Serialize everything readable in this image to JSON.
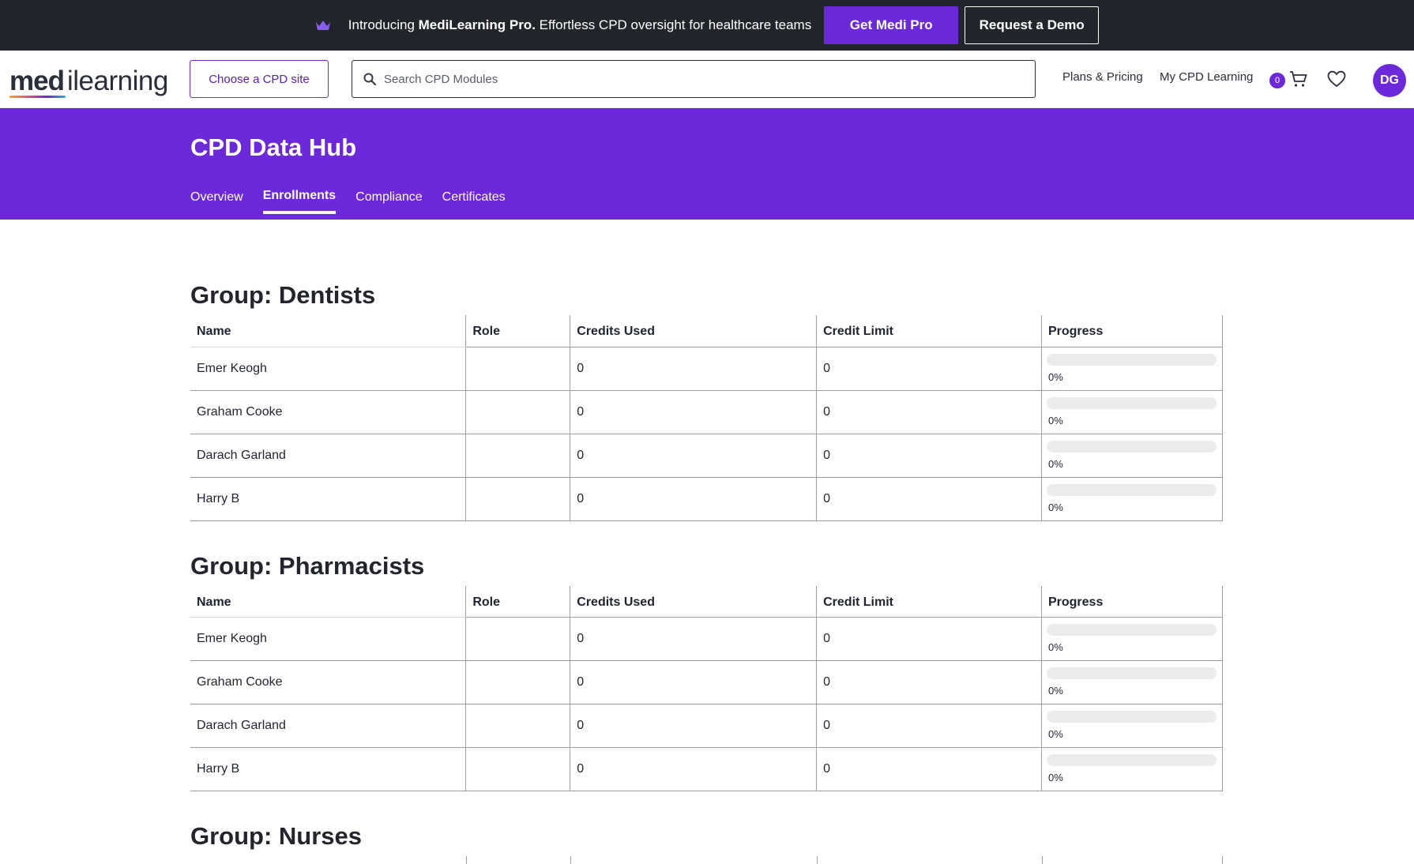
{
  "announcement": {
    "icon": "crown-icon",
    "intro": "Introducing ",
    "product": "MediLearning Pro.",
    "tagline": " Effortless CPD oversight for healthcare teams",
    "primary_cta": "Get Medi Pro",
    "secondary_cta": "Request a Demo"
  },
  "header": {
    "logo_bold": "med",
    "logo_light": "ilearning",
    "site_button": "Choose a CPD site",
    "search_placeholder": "Search CPD Modules",
    "nav": [
      "Plans & Pricing",
      "My CPD Learning"
    ],
    "cart_count": "0",
    "avatar_initials": "DG"
  },
  "hero": {
    "title": "CPD Data Hub",
    "tabs": [
      "Overview",
      "Enrollments",
      "Compliance",
      "Certificates"
    ],
    "active_tab": "Enrollments"
  },
  "table_headers": [
    "Name",
    "Role",
    "Credits Used",
    "Credit Limit",
    "Progress"
  ],
  "groups": [
    {
      "title": "Group: Dentists",
      "rows": [
        {
          "name": "Emer Keogh",
          "role": "",
          "credits_used": "0",
          "credit_limit": "0",
          "progress": "0%"
        },
        {
          "name": "Graham Cooke",
          "role": "",
          "credits_used": "0",
          "credit_limit": "0",
          "progress": "0%"
        },
        {
          "name": "Darach Garland",
          "role": "",
          "credits_used": "0",
          "credit_limit": "0",
          "progress": "0%"
        },
        {
          "name": "Harry B",
          "role": "",
          "credits_used": "0",
          "credit_limit": "0",
          "progress": "0%"
        }
      ]
    },
    {
      "title": "Group: Pharmacists",
      "rows": [
        {
          "name": "Emer Keogh",
          "role": "",
          "credits_used": "0",
          "credit_limit": "0",
          "progress": "0%"
        },
        {
          "name": "Graham Cooke",
          "role": "",
          "credits_used": "0",
          "credit_limit": "0",
          "progress": "0%"
        },
        {
          "name": "Darach Garland",
          "role": "",
          "credits_used": "0",
          "credit_limit": "0",
          "progress": "0%"
        },
        {
          "name": "Harry B",
          "role": "",
          "credits_used": "0",
          "credit_limit": "0",
          "progress": "0%"
        }
      ]
    },
    {
      "title": "Group: Nurses",
      "rows": []
    }
  ],
  "colors": {
    "brand": "#6d28d9",
    "announce_bg": "#23252d",
    "progress_track": "#ececee"
  }
}
